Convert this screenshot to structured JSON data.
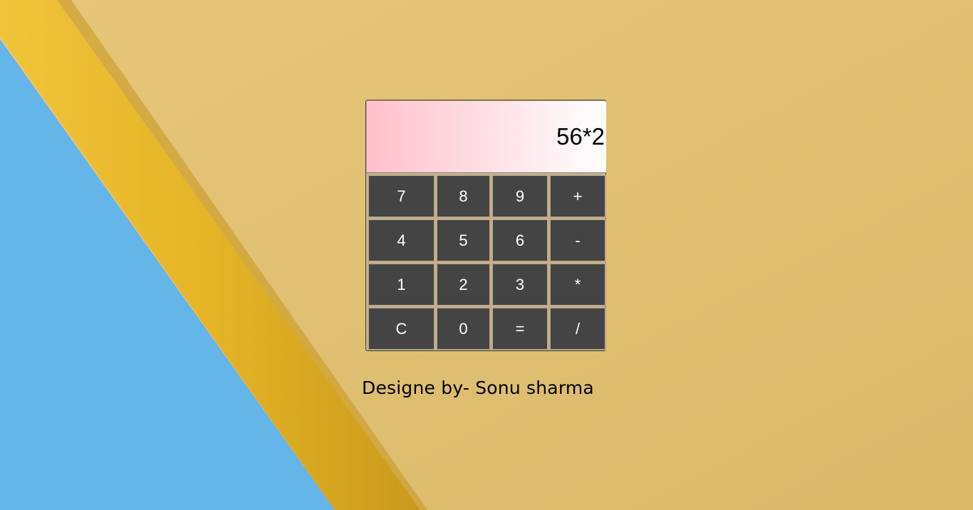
{
  "background": {
    "paper_color": "#dfc06f",
    "pencil_color": "#e8b82a",
    "blue_paper_color": "#63b4e8"
  },
  "calculator": {
    "display_value": "56*2",
    "keys": [
      [
        "7",
        "8",
        "9",
        "+"
      ],
      [
        "4",
        "5",
        "6",
        "-"
      ],
      [
        "1",
        "2",
        "3",
        "*"
      ],
      [
        "C",
        "0",
        "=",
        "/"
      ]
    ]
  },
  "credit": {
    "text": "Designe by- Sonu sharma"
  }
}
